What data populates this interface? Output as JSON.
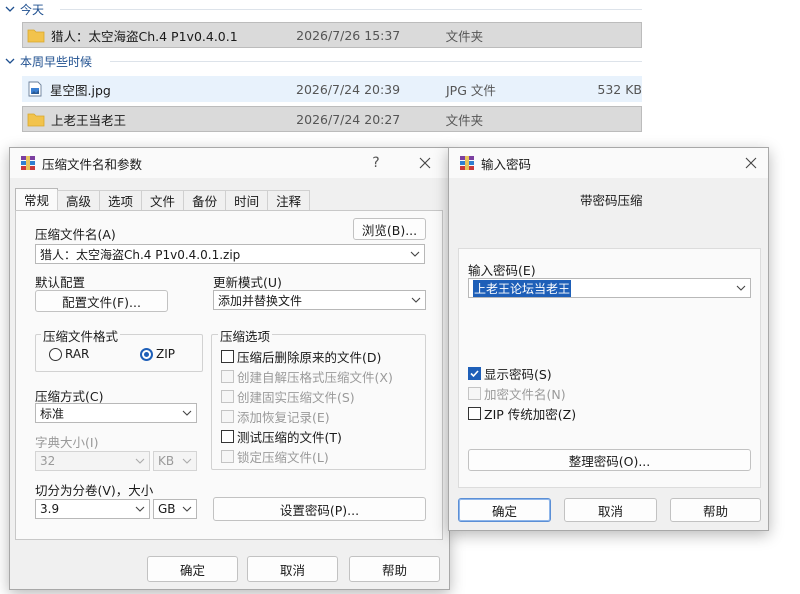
{
  "explorer": {
    "groups": [
      {
        "label": "今天"
      },
      {
        "label": "本周早些时候"
      }
    ],
    "files": [
      {
        "name": "猎人：太空海盗Ch.4 P1v0.4.0.1",
        "date": "2026/7/26 15:37",
        "type": "文件夹",
        "size": "",
        "icon": "folder-icon"
      },
      {
        "name": "星空图.jpg",
        "date": "2026/7/24 20:39",
        "type": "JPG 文件",
        "size": "532 KB",
        "icon": "image-file-icon"
      },
      {
        "name": "上老王当老王",
        "date": "2026/7/24 20:27",
        "type": "文件夹",
        "size": "",
        "icon": "folder-icon"
      }
    ]
  },
  "archive_dialog": {
    "title": "压缩文件名和参数",
    "help_glyph": "?",
    "tabs": [
      "常规",
      "高级",
      "选项",
      "文件",
      "备份",
      "时间",
      "注释"
    ],
    "archive_name_label": "压缩文件名(A)",
    "browse_label": "浏览(B)...",
    "archive_name_value": "猎人：太空海盗Ch.4 P1v0.4.0.1.zip",
    "default_profile_label": "默认配置",
    "profile_button": "配置文件(F)...",
    "update_mode_label": "更新模式(U)",
    "update_mode_value": "添加并替换文件",
    "format_group_label": "压缩文件格式",
    "format_rar": "RAR",
    "format_zip": "ZIP",
    "options_group_label": "压缩选项",
    "options": [
      {
        "label": "压缩后删除原来的文件(D)",
        "enabled": true,
        "checked": false
      },
      {
        "label": "创建自解压格式压缩文件(X)",
        "enabled": false,
        "checked": false
      },
      {
        "label": "创建固实压缩文件(S)",
        "enabled": false,
        "checked": false
      },
      {
        "label": "添加恢复记录(E)",
        "enabled": false,
        "checked": false
      },
      {
        "label": "测试压缩的文件(T)",
        "enabled": true,
        "checked": false
      },
      {
        "label": "锁定压缩文件(L)",
        "enabled": false,
        "checked": false
      }
    ],
    "method_label": "压缩方式(C)",
    "method_value": "标准",
    "dict_label": "字典大小(I)",
    "dict_value": "32",
    "dict_unit": "KB",
    "split_label": "切分为分卷(V)，大小",
    "split_value": "3.9",
    "split_unit": "GB",
    "set_password_button": "设置密码(P)...",
    "ok_button": "确定",
    "cancel_button": "取消",
    "help_button": "帮助"
  },
  "password_dialog": {
    "title": "输入密码",
    "header": "带密码压缩",
    "password_label": "输入密码(E)",
    "password_value": "上老王论坛当老王",
    "options": [
      {
        "label": "显示密码(S)",
        "enabled": true,
        "checked": true
      },
      {
        "label": "加密文件名(N)",
        "enabled": false,
        "checked": false
      },
      {
        "label": "ZIP 传统加密(Z)",
        "enabled": true,
        "checked": false
      }
    ],
    "manage_button": "整理密码(O)...",
    "ok_button": "确定",
    "cancel_button": "取消",
    "help_button": "帮助"
  },
  "colors": {
    "accent": "#1e5fb8",
    "selection": "#dadada",
    "folder": "#f2c34c"
  }
}
